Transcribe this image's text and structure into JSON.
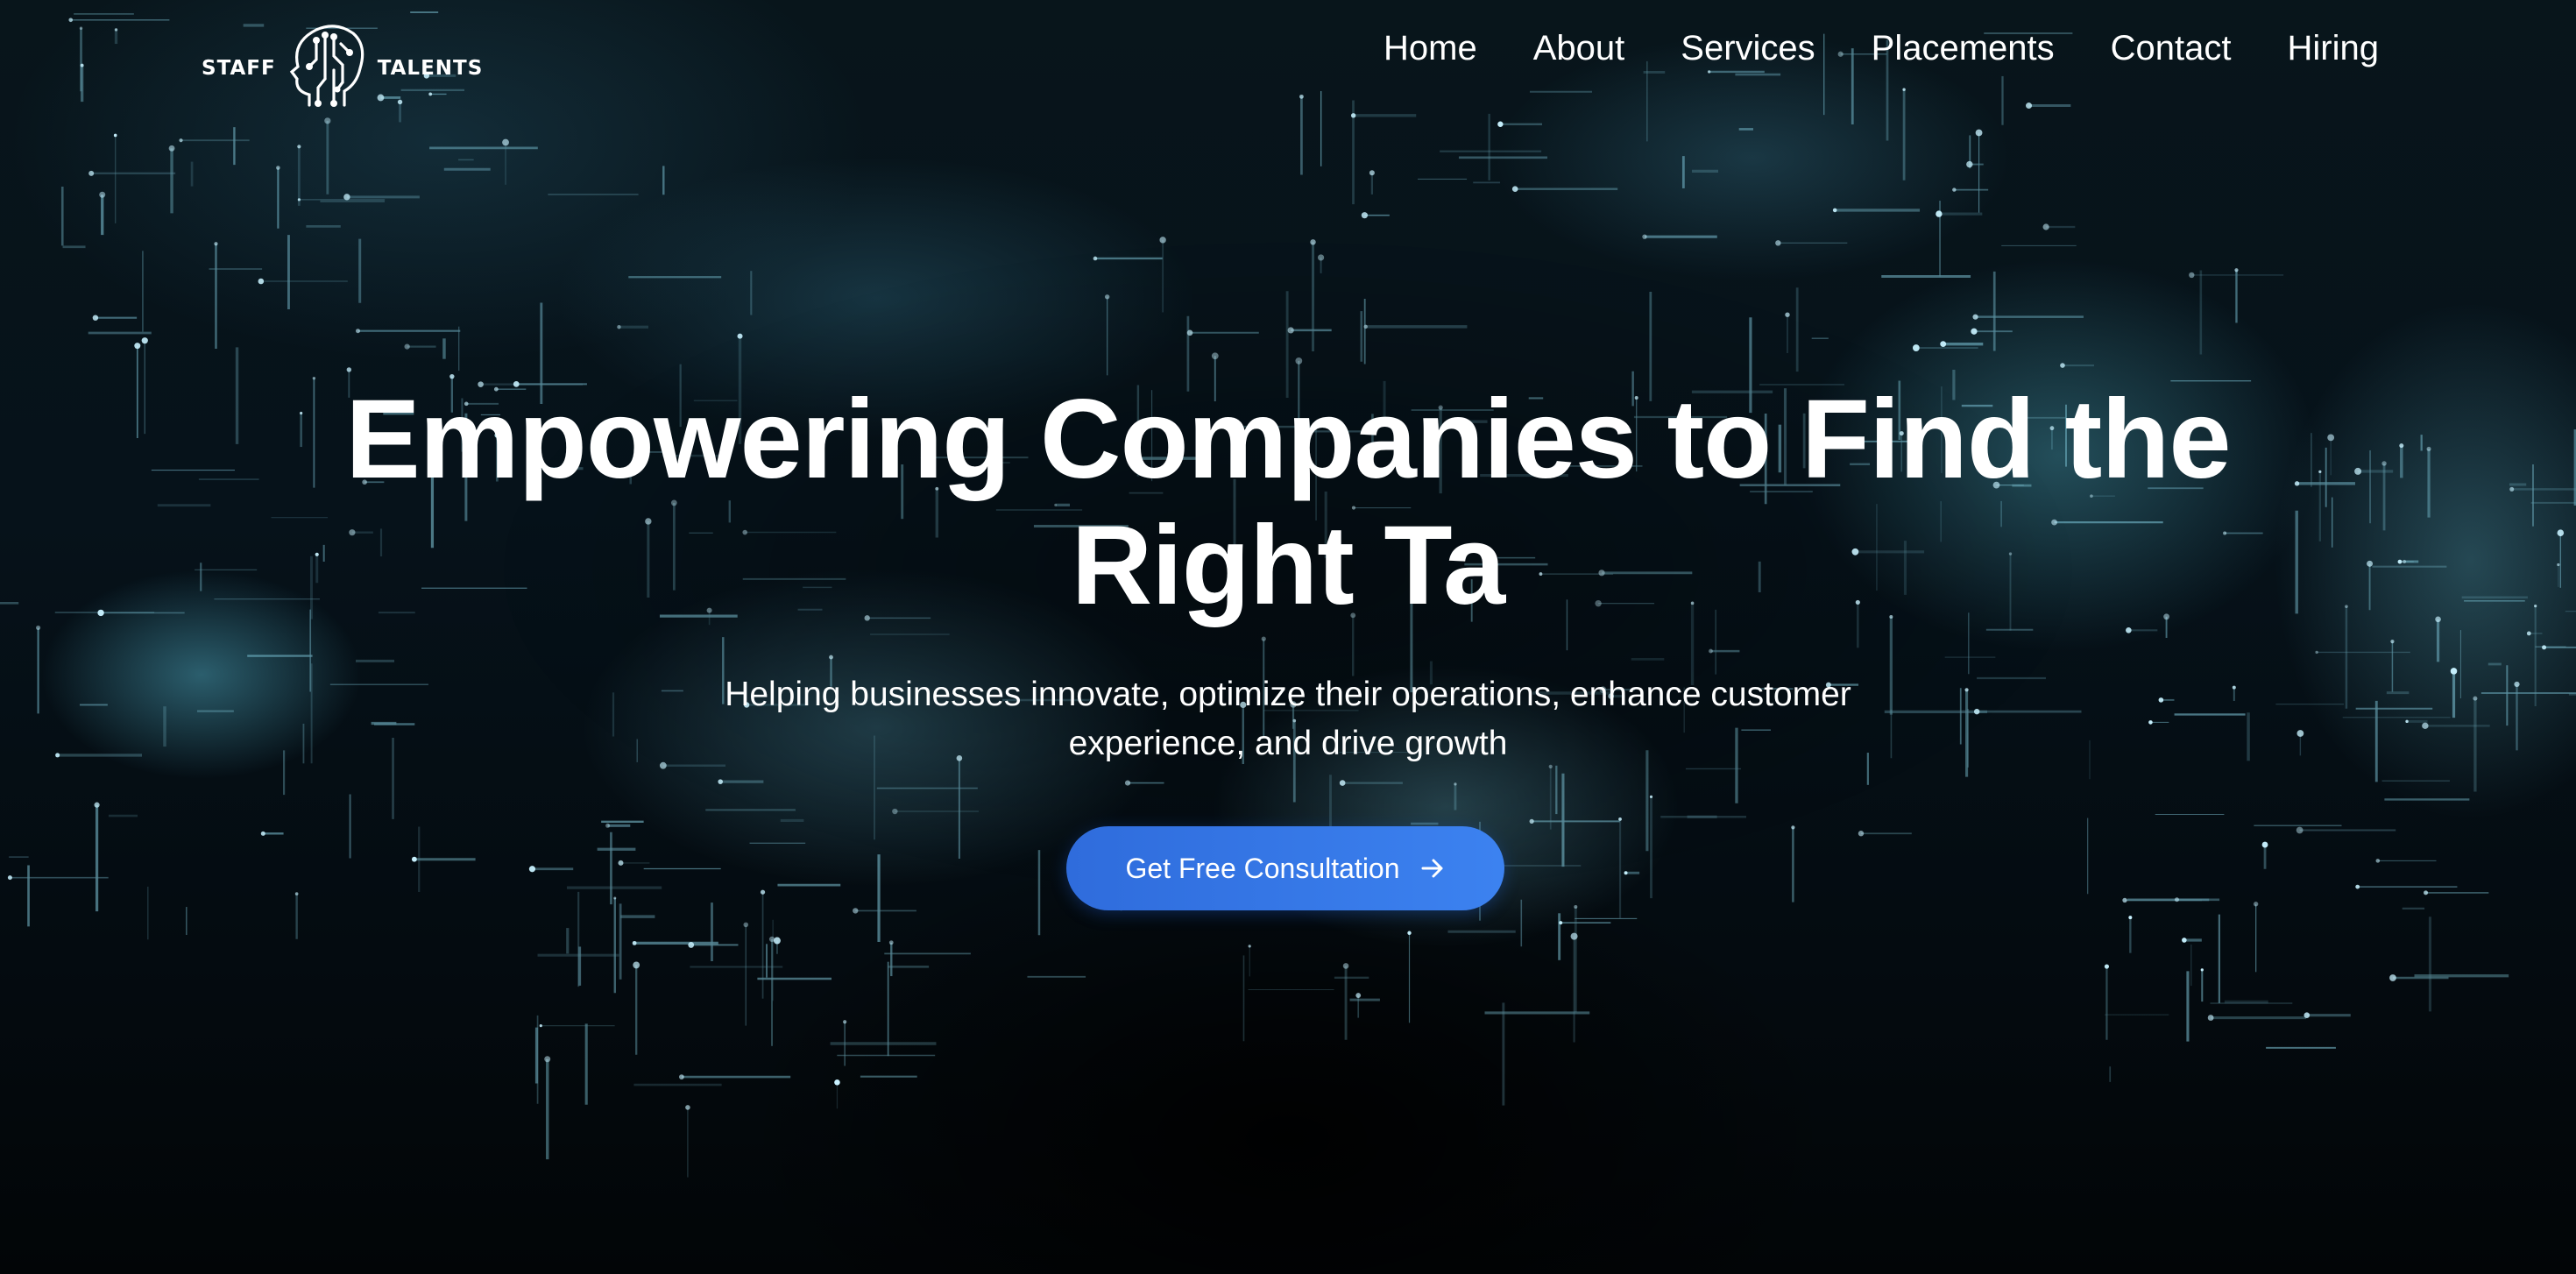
{
  "brand": {
    "left_word": "STAFF",
    "right_word": "TALENTS"
  },
  "nav": {
    "items": [
      {
        "label": "Home"
      },
      {
        "label": "About"
      },
      {
        "label": "Services"
      },
      {
        "label": "Placements"
      },
      {
        "label": "Contact"
      },
      {
        "label": "Hiring"
      }
    ]
  },
  "hero": {
    "headline_line1": "Empowering Companies to Find the",
    "headline_line2": "Right Ta",
    "subtext_line1": "Helping businesses innovate, optimize their operations, enhance customer",
    "subtext_line2": "experience, and drive growth",
    "cta_label": "Get Free Consultation",
    "cta_icon": "arrow-right-icon"
  },
  "colors": {
    "cta_background": "#3a7ded",
    "text": "#ffffff",
    "background": "#050d12",
    "accent_glow": "#7fd6ea"
  }
}
